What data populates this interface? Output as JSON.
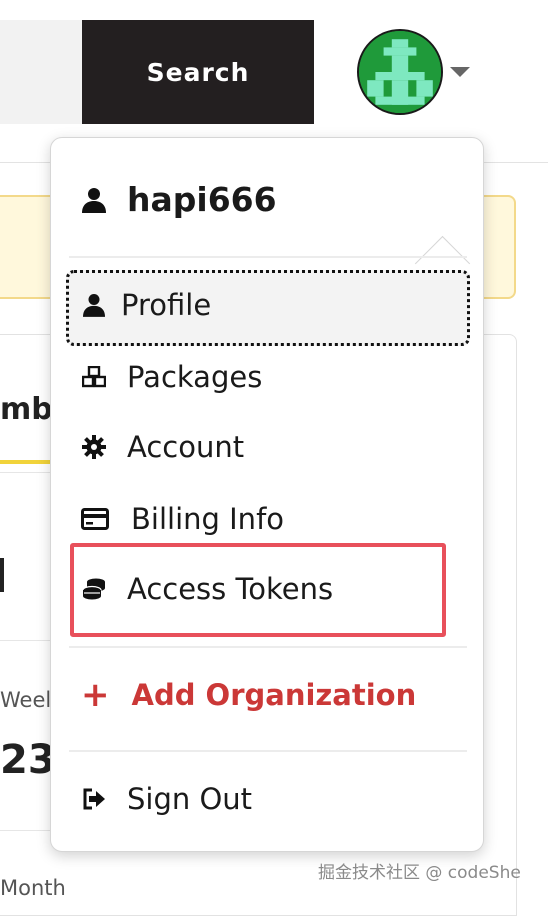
{
  "header": {
    "search_button_label": "Search",
    "avatar_alt": "user avatar"
  },
  "background": {
    "tab_fragment": "mb",
    "weekly_fragment": "Weel",
    "number_fragment": "23,",
    "monthly_fragment": "Month"
  },
  "menu": {
    "username": "hapi666",
    "items": [
      {
        "label": "Profile",
        "icon": "user-icon"
      },
      {
        "label": "Packages",
        "icon": "packages-icon"
      },
      {
        "label": "Account",
        "icon": "gear-icon"
      },
      {
        "label": "Billing Info",
        "icon": "credit-card-icon"
      },
      {
        "label": "Access Tokens",
        "icon": "coins-icon"
      }
    ],
    "add_organization": "Add Organization",
    "sign_out": "Sign Out"
  },
  "colors": {
    "accent_red": "#cb3837",
    "annotation_red": "#e8505b",
    "search_bg": "#231f20",
    "banner_bg": "#fff8dc"
  },
  "watermark": "掘金技术社区 @ codeShe"
}
